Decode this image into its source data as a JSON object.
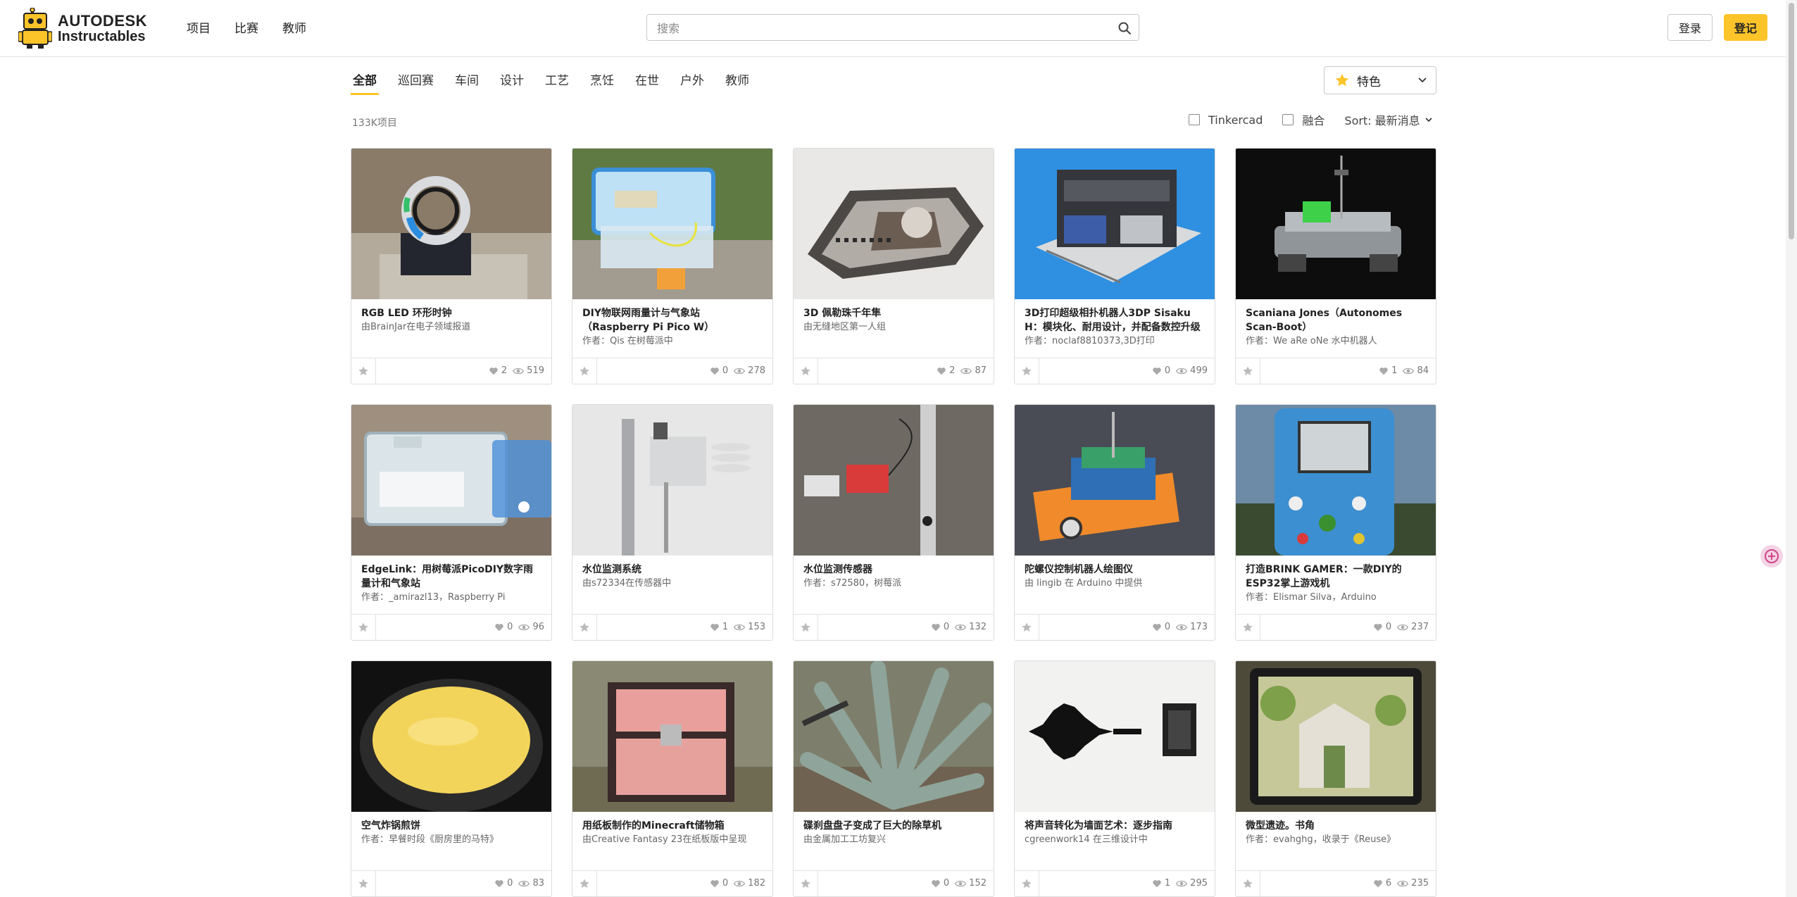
{
  "brand": {
    "line1": "AUTODESK",
    "line2": "Instructables"
  },
  "nav": [
    {
      "label": "项目"
    },
    {
      "label": "比赛"
    },
    {
      "label": "教师"
    }
  ],
  "search": {
    "placeholder": "搜索",
    "value": ""
  },
  "auth": {
    "login": "登录",
    "signup": "登记"
  },
  "tabs": [
    {
      "label": "全部",
      "active": true
    },
    {
      "label": "巡回赛"
    },
    {
      "label": "车间"
    },
    {
      "label": "设计"
    },
    {
      "label": "工艺"
    },
    {
      "label": "烹饪"
    },
    {
      "label": "在世"
    },
    {
      "label": "户外"
    },
    {
      "label": "教师"
    }
  ],
  "featured_select": {
    "label": "特色",
    "icon": "star-icon",
    "accent": "#fdc42a"
  },
  "count": "133K项目",
  "filters": [
    {
      "label": "Tinkercad",
      "checked": false
    },
    {
      "label": "融合",
      "checked": false
    }
  ],
  "sort": {
    "label": "Sort: 最新消息"
  },
  "cards": [
    {
      "title": "RGB LED 环形时钟",
      "author": "由BrainJar在电子领域报道",
      "likes": "2",
      "views": "519",
      "image": "ring-clock"
    },
    {
      "title": "DIY物联网雨量计与气象站（Raspberry Pi Pico W）",
      "author": "作者：Qis 在树莓派中",
      "likes": "0",
      "views": "278",
      "image": "weather-box"
    },
    {
      "title": "3D 佩勒珠千年隼",
      "author": "由无缝地区第一人组",
      "likes": "2",
      "views": "87",
      "image": "falcon"
    },
    {
      "title": "3D打印超级相扑机器人3DP Sisaku H：模块化、耐用设计，并配备数控升级",
      "author": "作者：noclaf8810373,3D打印",
      "likes": "0",
      "views": "499",
      "image": "sumo-robot"
    },
    {
      "title": "Scaniana Jones（Autonomes Scan-Boot）",
      "author": "作者：We aRe oNe 水中机器人",
      "likes": "1",
      "views": "84",
      "image": "scan-boat"
    },
    {
      "title": "EdgeLink：用树莓派PicoDIY数字雨量计和气象站",
      "author": "作者：_amirazl13，Raspberry Pi",
      "likes": "0",
      "views": "96",
      "image": "edgelink"
    },
    {
      "title": "水位监测系统",
      "author": "由s72334在传感器中",
      "likes": "1",
      "views": "153",
      "image": "water-pole"
    },
    {
      "title": "水位监测传感器",
      "author": "作者：s72580，树莓派",
      "likes": "0",
      "views": "132",
      "image": "water-sensor"
    },
    {
      "title": "陀螺仪控制机器人绘图仪",
      "author": "由 lingib 在 Arduino 中提供",
      "likes": "0",
      "views": "173",
      "image": "plotter"
    },
    {
      "title": "打造BRINK GAMER：一款DIY的ESP32掌上游戏机",
      "author": "作者：Elismar Silva，Arduino",
      "likes": "0",
      "views": "237",
      "image": "gamer"
    },
    {
      "title": "空气炸锅煎饼",
      "author": "作者：早餐时段《厨房里的马特》",
      "likes": "0",
      "views": "83",
      "image": "pancake"
    },
    {
      "title": "用纸板制作的Minecraft储物箱",
      "author": "由Creative Fantasy 23在纸板版中呈现",
      "likes": "0",
      "views": "182",
      "image": "chest"
    },
    {
      "title": "碟刹盘盘子变成了巨大的除草机",
      "author": "由金属加工工坊复兴",
      "likes": "0",
      "views": "152",
      "image": "agave"
    },
    {
      "title": "将声音转化为墙面艺术：逐步指南",
      "author": "cgreenwork14 在三维设计中",
      "likes": "1",
      "views": "295",
      "image": "soundwave"
    },
    {
      "title": "微型遗迹。书角",
      "author": "作者：evahghg，收录于《Reuse》",
      "likes": "6",
      "views": "235",
      "image": "ruins"
    }
  ]
}
